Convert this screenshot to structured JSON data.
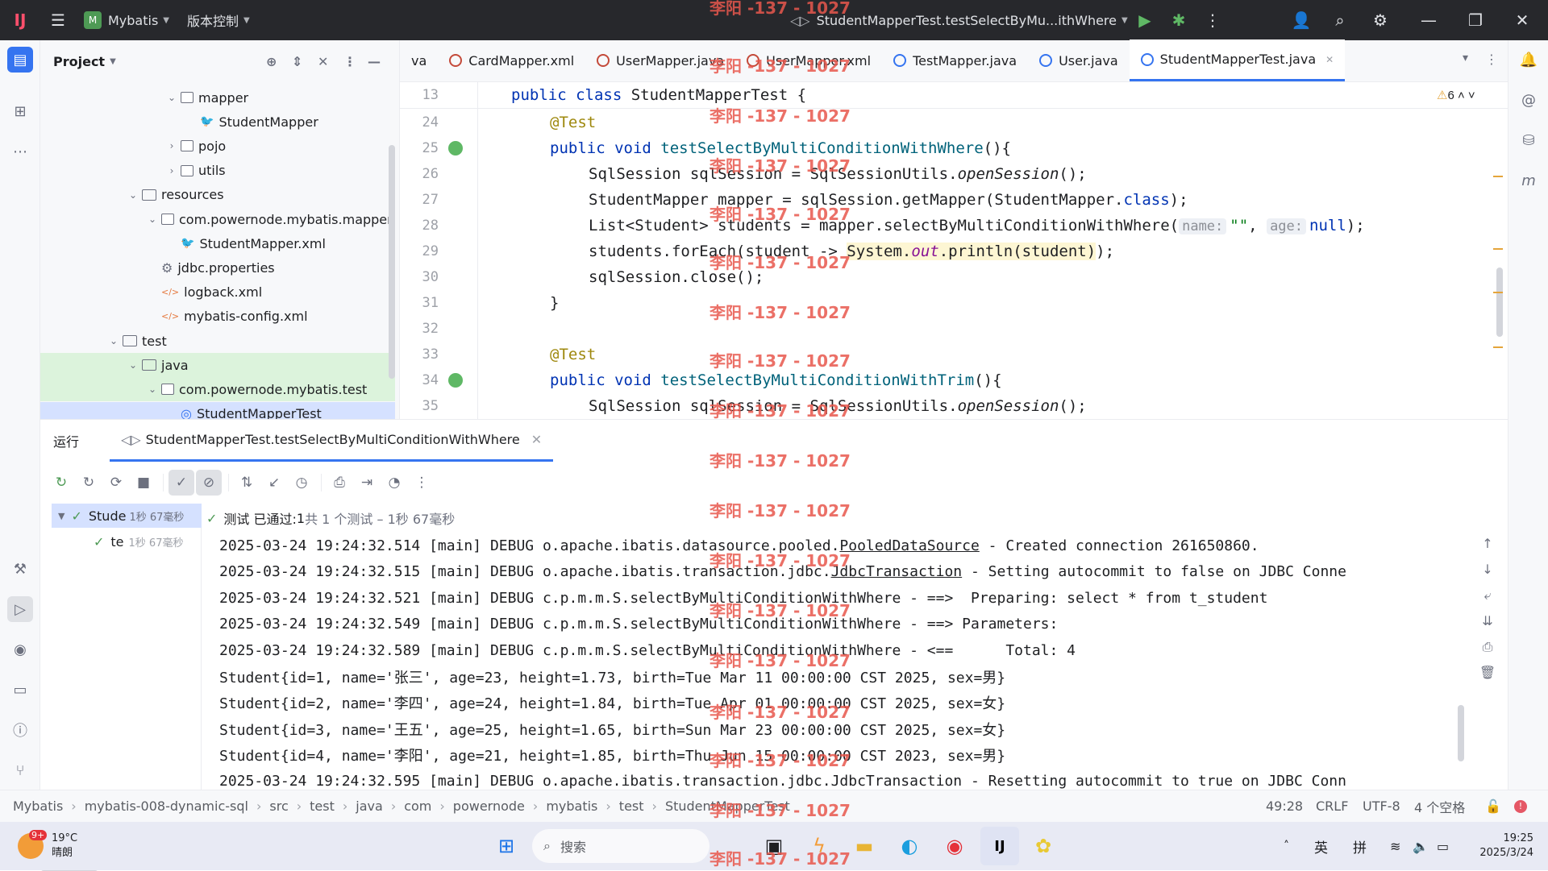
{
  "titlebar": {
    "project_badge": "M",
    "project_name": "Mybatis",
    "vcs_label": "版本控制",
    "run_config": "StudentMapperTest.testSelectByMu...ithWhere"
  },
  "project_panel": {
    "title": "Project",
    "tree": [
      {
        "label": "mapper",
        "kind": "package",
        "depth": 3
      },
      {
        "label": "StudentMapper",
        "kind": "mapper",
        "depth": 4
      },
      {
        "label": "pojo",
        "kind": "package",
        "depth": 3
      },
      {
        "label": "utils",
        "kind": "package",
        "depth": 3
      },
      {
        "label": "resources",
        "kind": "folder",
        "depth": 1
      },
      {
        "label": "com.powernode.mybatis.mapper",
        "kind": "package",
        "depth": 2
      },
      {
        "label": "StudentMapper.xml",
        "kind": "xml",
        "depth": 3
      },
      {
        "label": "jdbc.properties",
        "kind": "props",
        "depth": 2
      },
      {
        "label": "logback.xml",
        "kind": "xml-code",
        "depth": 2
      },
      {
        "label": "mybatis-config.xml",
        "kind": "xml-code",
        "depth": 2
      },
      {
        "label": "test",
        "kind": "folder",
        "depth": 0
      },
      {
        "label": "java",
        "kind": "folder",
        "depth": 1
      },
      {
        "label": "com.powernode.mybatis.test",
        "kind": "package",
        "depth": 2
      },
      {
        "label": "StudentMapperTest",
        "kind": "class",
        "depth": 3
      }
    ]
  },
  "editor": {
    "tabs": [
      "va",
      "CardMapper.xml",
      "UserMapper.java",
      "UserMapper.xml",
      "TestMapper.java",
      "User.java",
      "StudentMapperTest.java"
    ],
    "active_tab": "StudentMapperTest.java",
    "warnings_count": "6",
    "line_numbers": [
      "13",
      "24",
      "25",
      "26",
      "27",
      "28",
      "29",
      "30",
      "31",
      "32",
      "33",
      "34",
      "35"
    ],
    "code": {
      "l13_a": "public class",
      "l13_b": " StudentMapperTest {",
      "l24": "@Test",
      "l25_a": "public void ",
      "l25_b": "testSelectByMultiConditionWithWhere",
      "l25_c": "(){",
      "l26_a": "SqlSession sqlSession = SqlSessionUtils.",
      "l26_b": "openSession",
      "l26_c": "();",
      "l27_a": "StudentMapper mapper = sqlSession.getMapper(StudentMapper.",
      "l27_b": "class",
      "l27_c": ");",
      "l28_a": "List<Student> students = mapper.selectByMultiConditionWithWhere(",
      "l28_hint1": "name:",
      "l28_str": "\"\"",
      "l28_comma": ", ",
      "l28_hint2": "age:",
      "l28_null": "null",
      "l28_end": ");",
      "l29_a": "students.forEach(student -> ",
      "l29_b": "System.",
      "l29_c": "out",
      "l29_d": ".println(student)",
      "l29_e": ");",
      "l30": "sqlSession.close();",
      "l31": "}",
      "l33": "@Test",
      "l34_a": "public void ",
      "l34_b": "testSelectByMultiConditionWithTrim",
      "l34_c": "(){",
      "l35_a": "SqlSession sqlSession = SqlSessionUtils.",
      "l35_b": "openSession",
      "l35_c": "();"
    }
  },
  "run_panel": {
    "title": "运行",
    "tab_label": "StudentMapperTest.testSelectByMultiConditionWithWhere",
    "tree_root": "Stude",
    "tree_root_time": "1秒 67毫秒",
    "tree_child": "te",
    "tree_child_time": "1秒 67毫秒",
    "status_prefix": "测试 已通过: ",
    "status_count": "1",
    "status_suffix": "共 1 个测试 – 1秒 67毫秒",
    "console_lines": [
      {
        "pre": "2025-03-24 19:24:32.514 [main] DEBUG o.apache.ibatis.datasource.pooled.",
        "u": "PooledDataSource",
        "post": " - Created connection 261650860."
      },
      {
        "pre": "2025-03-24 19:24:32.515 [main] DEBUG o.apache.ibatis.transaction.jdbc.",
        "u": "JdbcTransaction",
        "post": " - Setting autocommit to false on JDBC Conne"
      },
      {
        "pre": "2025-03-24 19:24:32.521 [main] DEBUG c.p.m.m.S.selectByMultiConditionWithWhere - ==>  Preparing: select * from t_student",
        "u": "",
        "post": ""
      },
      {
        "pre": "2025-03-24 19:24:32.549 [main] DEBUG c.p.m.m.S.selectByMultiConditionWithWhere - ==> Parameters: ",
        "u": "",
        "post": ""
      },
      {
        "pre": "2025-03-24 19:24:32.589 [main] DEBUG c.p.m.m.S.selectByMultiConditionWithWhere - <==      Total: 4",
        "u": "",
        "post": ""
      },
      {
        "pre": "Student{id=1, name='张三', age=23, height=1.73, birth=Tue Mar 11 00:00:00 CST 2025, sex=男}",
        "u": "",
        "post": ""
      },
      {
        "pre": "Student{id=2, name='李四', age=24, height=1.84, birth=Tue Apr 01 00:00:00 CST 2025, sex=女}",
        "u": "",
        "post": ""
      },
      {
        "pre": "Student{id=3, name='王五', age=25, height=1.65, birth=Sun Mar 23 00:00:00 CST 2025, sex=女}",
        "u": "",
        "post": ""
      },
      {
        "pre": "Student{id=4, name='李阳', age=21, height=1.85, birth=Thu Jun 15 00:00:00 CST 2023, sex=男}",
        "u": "",
        "post": ""
      },
      {
        "pre": "2025-03-24 19:24:32.595 [main] DEBUG o.apache.ibatis.transaction.jdbc.JdbcTransaction - Resetting autocommit to true on JDBC Conn",
        "u": "",
        "post": ""
      }
    ]
  },
  "statusbar": {
    "breadcrumbs": [
      "Mybatis",
      "mybatis-008-dynamic-sql",
      "src",
      "test",
      "java",
      "com",
      "powernode",
      "mybatis",
      "test",
      "StudentMapperTest"
    ],
    "position": "49:28",
    "line_sep": "CRLF",
    "encoding": "UTF-8",
    "indent": "4 个空格"
  },
  "watermark": "李阳 -137 - 1027",
  "taskbar": {
    "weather_badge": "9+",
    "temp": "19°C",
    "weather": "晴朗",
    "search_placeholder": "搜索",
    "ime1": "英",
    "ime2": "拼",
    "time": "19:25",
    "date": "2025/3/24"
  },
  "colors": {
    "accent": "#3574f0",
    "keyword": "#0033b3",
    "annotation": "#9e880d",
    "method": "#00627a",
    "string": "#067d17",
    "pass": "#4e9a55"
  }
}
